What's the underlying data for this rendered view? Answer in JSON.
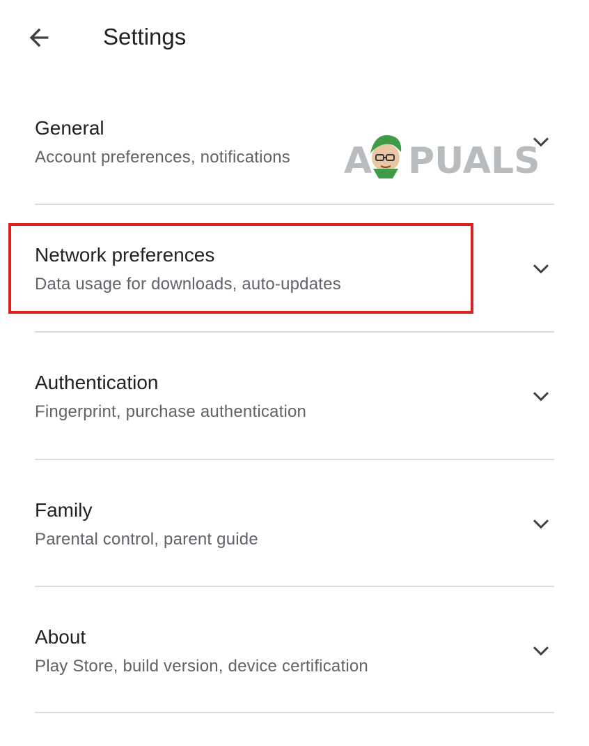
{
  "app_bar": {
    "title": "Settings",
    "back_icon": "arrow-back-icon"
  },
  "sections": [
    {
      "title": "General",
      "subtitle": "Account preferences, notifications",
      "icon": "chevron-down-icon"
    },
    {
      "title": "Network preferences",
      "subtitle": "Data usage for downloads, auto-updates",
      "icon": "chevron-down-icon"
    },
    {
      "title": "Authentication",
      "subtitle": "Fingerprint, purchase authentication",
      "icon": "chevron-down-icon"
    },
    {
      "title": "Family",
      "subtitle": "Parental control, parent guide",
      "icon": "chevron-down-icon"
    },
    {
      "title": "About",
      "subtitle": "Play Store, build version, device certification",
      "icon": "chevron-down-icon"
    }
  ],
  "highlight": {
    "target": "Network preferences",
    "color": "#e0201e"
  },
  "watermark": {
    "text": "APPUALS"
  },
  "colors": {
    "primary_text": "#202124",
    "secondary_text": "#5f6368",
    "divider": "#dadce0"
  }
}
